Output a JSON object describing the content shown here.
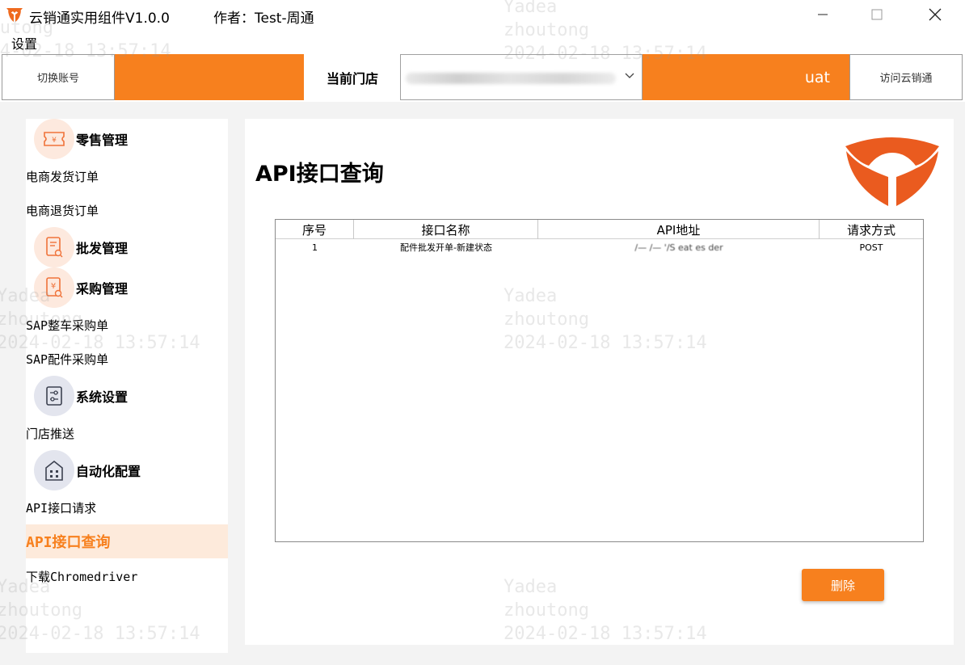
{
  "titlebar": {
    "title": "云销通实用组件V1.0.0",
    "author": "作者：Test-周通"
  },
  "menubar": {
    "settings_label": "设置"
  },
  "toolbar": {
    "switch_account_label": "切换账号",
    "current_store_label": "当前门店",
    "env_label": "uat",
    "visit_label": "访问云销通"
  },
  "sidebar": {
    "retail_group": "零售管理",
    "ecom_ship": "电商发货订单",
    "ecom_return": "电商退货订单",
    "wholesale_group": "批发管理",
    "purchase_group": "采购管理",
    "sap_vehicle": "SAP整车采购单",
    "sap_parts": "SAP配件采购单",
    "system_group": "系统设置",
    "store_push": "门店推送",
    "automation_group": "自动化配置",
    "api_request": "API接口请求",
    "api_query": "API接口查询",
    "download_driver": "下载Chromedriver"
  },
  "main": {
    "title": "API接口查询",
    "table": {
      "headers": [
        "序号",
        "接口名称",
        "API地址",
        "请求方式"
      ],
      "rows": [
        [
          "1",
          "配件批发开单-新建状态",
          "/— /— '/S  eat   es  der",
          "POST"
        ]
      ]
    },
    "delete_label": "删除"
  },
  "watermark": {
    "line1": "Yadea",
    "line2": "zhoutong",
    "line3": "2024-02-18 13:57:14"
  },
  "colors": {
    "accent": "#f7801e",
    "active_bg": "#fdeadb"
  }
}
